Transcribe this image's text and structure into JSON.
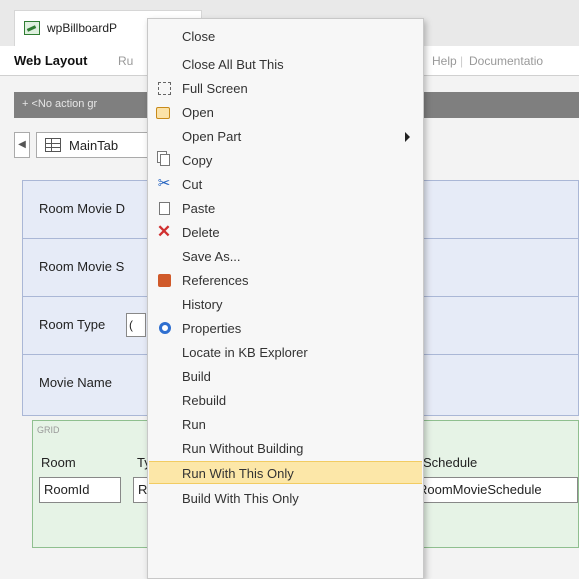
{
  "document": {
    "tab_title": "wpBillboardP"
  },
  "toolbar": {
    "web_layout_tab": "Web Layout",
    "rules_fragment": "Ru",
    "help_tab": "Help",
    "documentation_tab": "Documentatio"
  },
  "actionbar": {
    "text": "+ <No action gr"
  },
  "maintab": {
    "label": "MainTab"
  },
  "form": {
    "rows": [
      {
        "label": "Room Movie D"
      },
      {
        "label": "Room Movie S"
      },
      {
        "label": "Room Type",
        "value": "("
      },
      {
        "label": "Movie Name"
      }
    ]
  },
  "grid": {
    "caption": "GRID",
    "headers": [
      "Room",
      "Ty",
      "Schedule"
    ],
    "cells": [
      "RoomId",
      "R",
      "RoomMovieSchedule"
    ]
  },
  "context_menu": {
    "items": [
      {
        "label": "Close",
        "icon": ""
      },
      {
        "label": "Close All But This",
        "icon": ""
      },
      {
        "label": "Full Screen",
        "icon": "fullscreen-icon"
      },
      {
        "label": "Open",
        "icon": "open-icon"
      },
      {
        "label": "Open Part",
        "icon": "",
        "submenu": true
      },
      {
        "label": "Copy",
        "icon": "copy-icon"
      },
      {
        "label": "Cut",
        "icon": "cut-icon"
      },
      {
        "label": "Paste",
        "icon": "paste-icon"
      },
      {
        "label": "Delete",
        "icon": "delete-icon"
      },
      {
        "label": "Save As...",
        "icon": ""
      },
      {
        "label": "References",
        "icon": "references-icon"
      },
      {
        "label": "History",
        "icon": ""
      },
      {
        "label": "Properties",
        "icon": "properties-icon"
      },
      {
        "label": "Locate in KB Explorer",
        "icon": ""
      },
      {
        "label": "Build",
        "icon": ""
      },
      {
        "label": "Rebuild",
        "icon": ""
      },
      {
        "label": "Run",
        "icon": ""
      },
      {
        "label": "Run Without Building",
        "icon": ""
      },
      {
        "label": "Run With This Only",
        "icon": "",
        "highlighted": true
      },
      {
        "label": "Build With This Only",
        "icon": ""
      }
    ]
  },
  "colors": {
    "menu_highlight": "#fce7a8",
    "form_background": "#e6ebf7",
    "grid_background": "#e6f3e6"
  }
}
